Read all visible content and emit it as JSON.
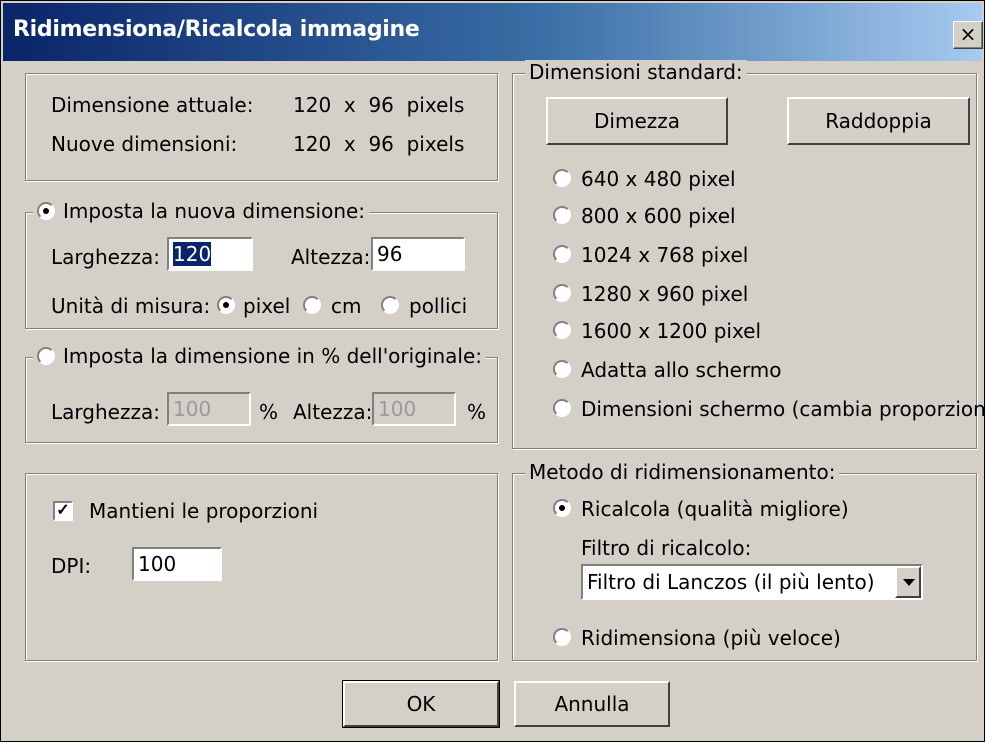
{
  "window": {
    "title": "Ridimensiona/Ricalcola immagine",
    "close_glyph": "×"
  },
  "info": {
    "current_label": "Dimensione attuale:",
    "current_value": "120  x  96  pixels",
    "new_label": "Nuove dimensioni:",
    "new_value": "120  x  96  pixels"
  },
  "new_size": {
    "legend": "Imposta la nuova dimensione:",
    "selected": true,
    "width_label": "Larghezza:",
    "width_value": "120",
    "height_label": "Altezza:",
    "height_value": "96",
    "units_label": "Unità di misura:",
    "units": [
      {
        "label": "pixel",
        "selected": true
      },
      {
        "label": "cm",
        "selected": false
      },
      {
        "label": "pollici",
        "selected": false
      }
    ]
  },
  "percent": {
    "legend": "Imposta la dimensione in % dell'originale:",
    "selected": false,
    "width_label": "Larghezza:",
    "width_value": "100",
    "height_label": "Altezza:",
    "height_value": "100",
    "unit": "%"
  },
  "options": {
    "keep_ratio_label": "Mantieni le proporzioni",
    "keep_ratio_checked": true,
    "check_glyph": "✓",
    "dpi_label": "DPI:",
    "dpi_value": "100"
  },
  "standard": {
    "legend": "Dimensioni standard:",
    "half_button": "Dimezza",
    "double_button": "Raddoppia",
    "options": [
      "640 x 480 pixel",
      "800 x 600 pixel",
      "1024 x 768 pixel",
      "1280 x 960 pixel",
      "1600 x 1200 pixel",
      "Adatta allo schermo",
      "Dimensioni schermo (cambia proporzioni)"
    ]
  },
  "method": {
    "legend": "Metodo di ridimensionamento:",
    "resample_label": "Ricalcola (qualità migliore)",
    "resample_selected": true,
    "filter_label": "Filtro di ricalcolo:",
    "filter_value": "Filtro di Lanczos (il più lento)",
    "resize_label": "Ridimensiona (più veloce)"
  },
  "buttons": {
    "ok": "OK",
    "cancel": "Annulla"
  }
}
